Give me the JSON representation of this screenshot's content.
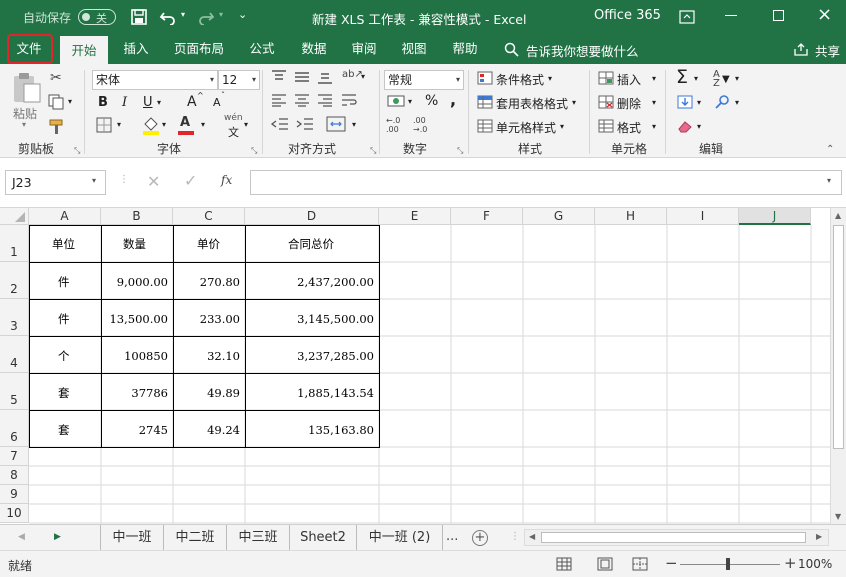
{
  "titlebar": {
    "autosave_label": "自动保存",
    "autosave_state": "关",
    "doc_title": "新建 XLS 工作表  -  兼容性模式  -  Excel",
    "account": "Office 365"
  },
  "tabs": [
    "文件",
    "开始",
    "插入",
    "页面布局",
    "公式",
    "数据",
    "审阅",
    "视图",
    "帮助"
  ],
  "tell_me": "告诉我你想要做什么",
  "share_label": "共享",
  "ribbon": {
    "clipboard": {
      "paste": "粘贴",
      "group": "剪贴板"
    },
    "font": {
      "name": "宋体",
      "size": "12",
      "bold": "B",
      "italic": "I",
      "underline": "U",
      "grow": "A",
      "shrink": "A",
      "wen": "wén",
      "group": "字体"
    },
    "align": {
      "group": "对齐方式"
    },
    "number": {
      "format": "常规",
      "percent": "%",
      "comma": ",",
      "group": "数字"
    },
    "styles": {
      "conditional": "条件格式",
      "table": "套用表格格式",
      "cell": "单元格样式",
      "group": "样式"
    },
    "cells": {
      "insert": "插入",
      "delete": "删除",
      "format": "格式",
      "group": "单元格"
    },
    "editing": {
      "group": "编辑"
    }
  },
  "formula": {
    "namebox": "J23",
    "fx": "fx",
    "value": ""
  },
  "columns": [
    "A",
    "B",
    "C",
    "D",
    "E",
    "F",
    "G",
    "H",
    "I",
    "J"
  ],
  "rows": [
    "1",
    "2",
    "3",
    "4",
    "5",
    "6",
    "7",
    "8",
    "9",
    "10"
  ],
  "table": {
    "header": [
      "单位",
      "数量",
      "单价",
      "合同总价"
    ],
    "rows": [
      [
        "件",
        "9,000.00",
        "270.80",
        "2,437,200.00"
      ],
      [
        "件",
        "13,500.00",
        "233.00",
        "3,145,500.00"
      ],
      [
        "个",
        "100850",
        "32.10",
        "3,237,285.00"
      ],
      [
        "套",
        "37786",
        "49.89",
        "1,885,143.54"
      ],
      [
        "套",
        "2745",
        "49.24",
        "135,163.80"
      ]
    ]
  },
  "sheets": [
    "中一班",
    "中二班",
    "中三班",
    "Sheet2",
    "中一班 (2)"
  ],
  "sheets_more": "...",
  "status": {
    "ready": "就绪",
    "zoom": "100%"
  },
  "colors": {
    "accent": "#217346",
    "highlight_box": "#e0262b"
  }
}
